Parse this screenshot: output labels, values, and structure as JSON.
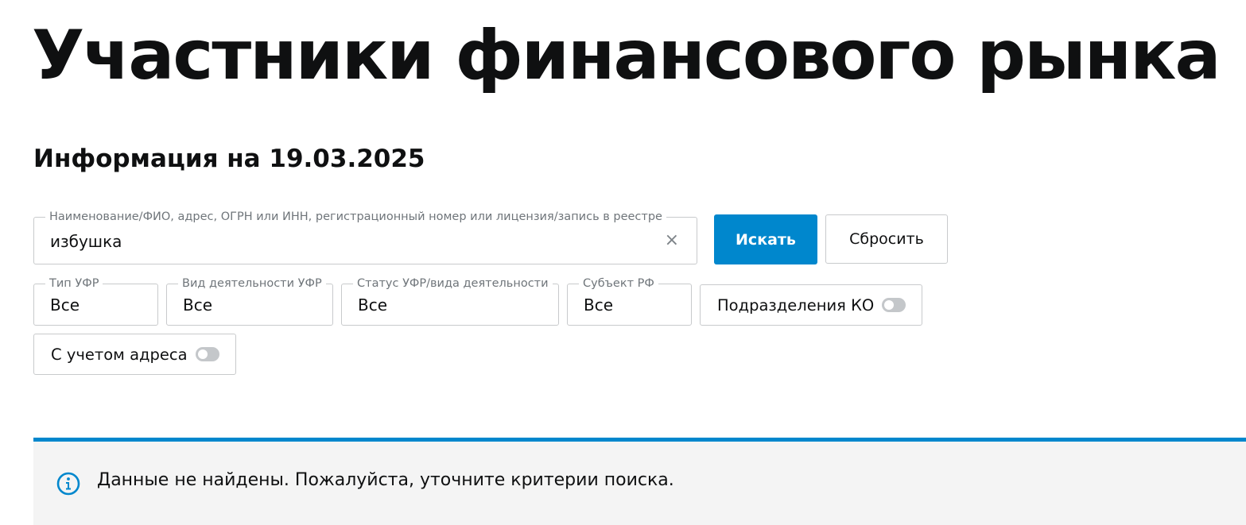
{
  "page": {
    "title": "Участники финансового рынка",
    "info_date": "Информация на 19.03.2025"
  },
  "search": {
    "label": "Наименование/ФИО, адрес, ОГРН или ИНН, регистрационный номер или лицензия/запись в реестре",
    "value": "избушка",
    "clear_symbol": "×",
    "search_button": "Искать",
    "reset_button": "Сбросить"
  },
  "filters": {
    "type": {
      "label": "Тип УФР",
      "value": "Все"
    },
    "activity": {
      "label": "Вид деятельности УФР",
      "value": "Все"
    },
    "status": {
      "label": "Статус УФР/вида деятельности",
      "value": "Все"
    },
    "subject": {
      "label": "Субъект РФ",
      "value": "Все"
    },
    "ko_divisions": {
      "label": "Подразделения КО",
      "enabled": false
    },
    "with_address": {
      "label": "С учетом адреса",
      "enabled": false
    }
  },
  "alert": {
    "message": "Данные не найдены. Пожалуйста, уточните критерии поиска.",
    "icon": "info-icon"
  },
  "colors": {
    "accent": "#0087cd",
    "alert_background": "#f4f4f4",
    "border": "#c8cacc",
    "toggle_off": "#c4c7ca"
  }
}
